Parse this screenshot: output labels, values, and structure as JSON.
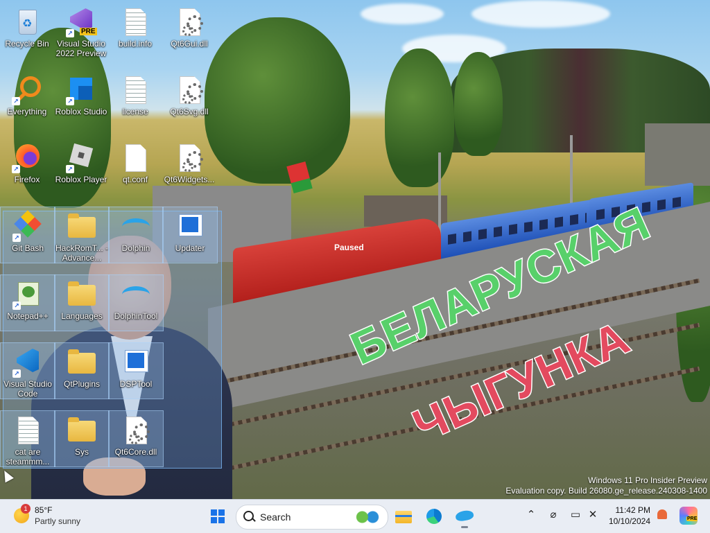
{
  "wallpaper": {
    "paused_label": "Paused",
    "title_line1": "БЕЛАРУСКАЯ",
    "title_line2": "ЧЫГУНКА",
    "title_colors": {
      "line1": "#58d06a",
      "line2": "#e34a5f"
    }
  },
  "desktop_icons": [
    {
      "label": "Recycle Bin",
      "icon": "recycle-bin-icon"
    },
    {
      "label": "Visual Studio 2022 Preview",
      "icon": "visual-studio-preview-icon",
      "badge": "PRE"
    },
    {
      "label": "build.info",
      "icon": "text-file-icon"
    },
    {
      "label": "Qt6Gui.dll",
      "icon": "dll-file-icon"
    },
    {
      "label": "Everything",
      "icon": "everything-search-icon"
    },
    {
      "label": "Roblox Studio",
      "icon": "roblox-studio-icon"
    },
    {
      "label": "license",
      "icon": "text-file-icon"
    },
    {
      "label": "Qt6Svg.dll",
      "icon": "dll-file-icon"
    },
    {
      "label": "Firefox",
      "icon": "firefox-icon"
    },
    {
      "label": "Roblox Player",
      "icon": "roblox-player-icon"
    },
    {
      "label": "qt.conf",
      "icon": "blank-file-icon"
    },
    {
      "label": "Qt6Widgets...",
      "icon": "dll-file-icon"
    },
    {
      "label": "Git Bash",
      "icon": "git-bash-icon"
    },
    {
      "label": "HackRomT... - Advance...",
      "icon": "folder-icon"
    },
    {
      "label": "Dolphin",
      "icon": "dolphin-emulator-icon"
    },
    {
      "label": "Updater",
      "icon": "updater-app-icon"
    },
    {
      "label": "Notepad++",
      "icon": "notepad-plus-plus-icon"
    },
    {
      "label": "Languages",
      "icon": "folder-icon"
    },
    {
      "label": "DolphinTool",
      "icon": "dolphin-tool-icon"
    },
    {
      "label": "Visual Studio Code",
      "icon": "vscode-icon"
    },
    {
      "label": "QtPlugins",
      "icon": "folder-icon"
    },
    {
      "label": "DSPTool",
      "icon": "dsp-tool-icon"
    },
    {
      "label": "cat are steammm...",
      "icon": "text-file-icon"
    },
    {
      "label": "Sys",
      "icon": "folder-icon"
    },
    {
      "label": "Qt6Core.dll",
      "icon": "dll-file-icon"
    }
  ],
  "watermark": {
    "line1": "Windows 11 Pro Insider Preview",
    "line2": "Evaluation copy. Build 26080.ge_release.240308-1400"
  },
  "taskbar": {
    "weather": {
      "temp": "85°F",
      "condition": "Partly sunny",
      "badge": "1"
    },
    "search_label": "Search",
    "pinned": [
      "start-icon",
      "file-explorer-icon",
      "edge-icon",
      "dolphin-icon"
    ],
    "tray": [
      "chevron-up-icon",
      "network-off-icon",
      "display-icon",
      "volume-muted-icon"
    ],
    "clock": {
      "time": "11:42 PM",
      "date": "10/10/2024"
    },
    "copilot_badge": "PRE",
    "accent": "#1a73e8",
    "background": "#e9edf4"
  }
}
